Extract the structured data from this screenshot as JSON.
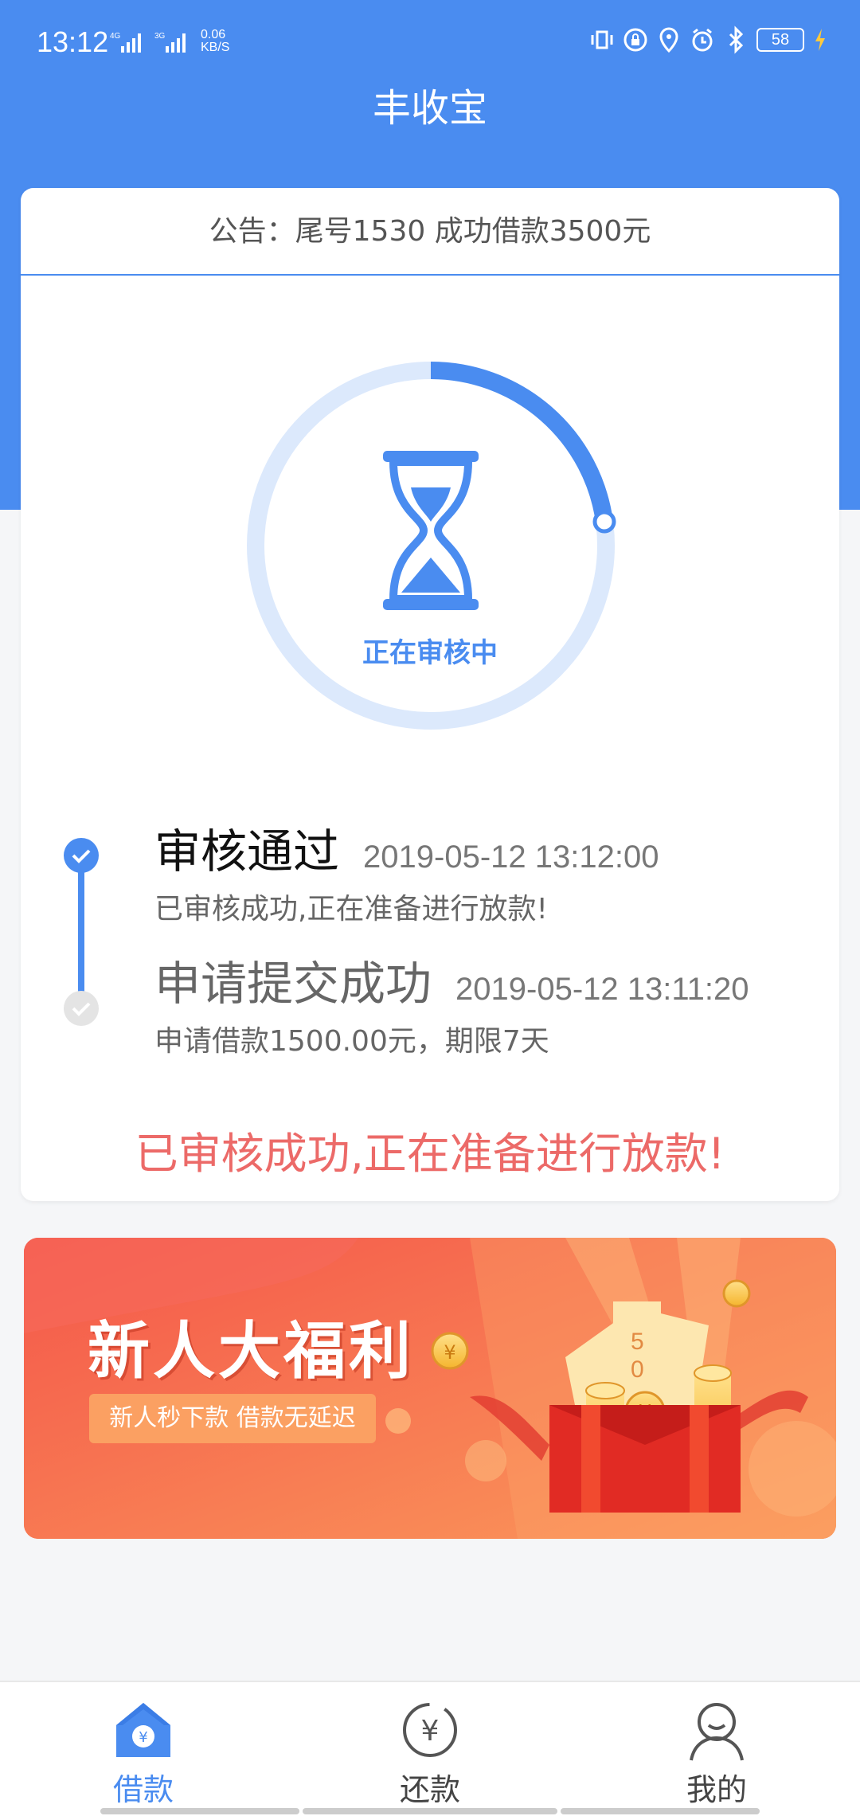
{
  "colors": {
    "primary": "#4a8cf0",
    "alert": "#ec6a68",
    "banner": "#f56a45"
  },
  "status_bar": {
    "time": "13:12",
    "network1": "4G",
    "network2": "3G",
    "speed_value": "0.06",
    "speed_unit": "KB/S",
    "battery": "58",
    "icons": [
      "vibrate-icon",
      "lock-rotation-icon",
      "location-icon",
      "alarm-icon",
      "bluetooth-icon",
      "battery-icon",
      "charging-icon"
    ]
  },
  "header": {
    "title": "丰收宝"
  },
  "notice": {
    "text": "公告：尾号1530 成功借款3500元"
  },
  "review": {
    "status_label": "正在审核中",
    "icon": "hourglass-icon"
  },
  "timeline": [
    {
      "title": "审核通过",
      "time": "2019-05-12 13:12:00",
      "desc": "已审核成功,正在准备进行放款!",
      "state": "active"
    },
    {
      "title": "申请提交成功",
      "time": "2019-05-12 13:11:20",
      "desc": "申请借款1500.00元，期限7天",
      "state": "done"
    }
  ],
  "status_message": "已审核成功,正在准备进行放款!",
  "banner": {
    "title": "新人大福利",
    "tag": "新人秒下款  借款无延迟"
  },
  "tabs": [
    {
      "label": "借款",
      "icon": "home-yuan-icon",
      "active": true
    },
    {
      "label": "还款",
      "icon": "repay-yuan-icon",
      "active": false
    },
    {
      "label": "我的",
      "icon": "user-icon",
      "active": false
    }
  ]
}
